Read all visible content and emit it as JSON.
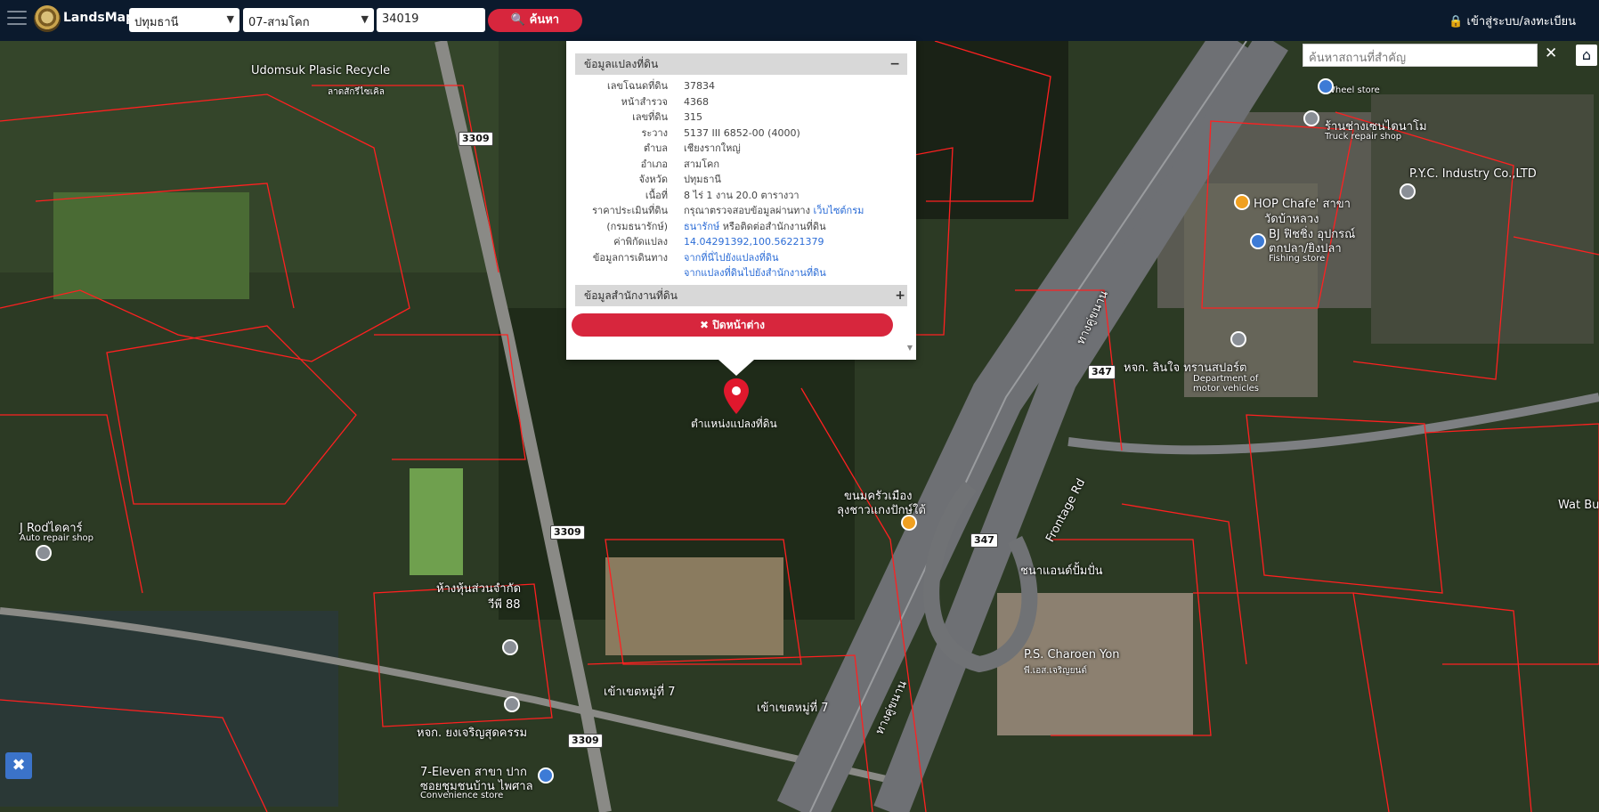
{
  "topbar": {
    "app_name": "LandsMaps",
    "province": "ปทุมธานี",
    "district": "07-สามโคก",
    "parcel_number": "34019",
    "search_label": "ค้นหา",
    "login_label": "เข้าสู่ระบบ/ลงทะเบียน"
  },
  "popup": {
    "section_title": "ข้อมูลแปลงที่ดิน",
    "rows": [
      {
        "k": "เลขโฉนดที่ดิน",
        "v": "37834"
      },
      {
        "k": "หน้าสำรวจ",
        "v": "4368"
      },
      {
        "k": "เลขที่ดิน",
        "v": "315"
      },
      {
        "k": "ระวาง",
        "v": "5137 III 6852-00 (4000)"
      },
      {
        "k": "ตำบล",
        "v": "เชียงรากใหญ่"
      },
      {
        "k": "อำเภอ",
        "v": "สามโคก"
      },
      {
        "k": "จังหวัด",
        "v": "ปทุมธานี"
      },
      {
        "k": "เนื้อที่",
        "v": "8 ไร่ 1 งาน 20.0 ตารางวา"
      }
    ],
    "price_label": "ราคาประเมินที่ดิน",
    "price_label2": "(กรมธนารักษ์)",
    "price_text1": "กรุณาตรวจสอบข้อมูลผ่านทาง",
    "price_link1": "เว็บไซต์กรม",
    "price_link2": "ธนารักษ์",
    "price_text2": "หรือติดต่อสำนักงานที่ดิน",
    "coord_label": "ค่าพิกัดแปลง",
    "coord_value": "14.04291392,100.56221379",
    "travel_label": "ข้อมูลการเดินทาง",
    "travel_link1": "จากที่นี่ไปยังแปลงที่ดิน",
    "travel_link2": "จากแปลงที่ดินไปยังสำนักงานที่ดิน",
    "section2_title": "ข้อมูลสำนักงานที่ดิน",
    "close_label": "✖ ปิดหน้าต่าง"
  },
  "map": {
    "pin_label": "ตำแหน่งแปลงที่ดิน",
    "place_search_placeholder": "ค้นหาสถานที่สำคัญ",
    "labels": {
      "udomsuk": "Udomsuk Plasic Recycle",
      "udomsuk_th": "ลาดสักรีไซเคิล",
      "wheel": "Wheel store",
      "truck_th": "ร้านช่างเซนไดนาโม",
      "truck": "Truck repair shop",
      "pyc": "P.Y.C. Industry Co.,LTD",
      "hop": "HOP Chafe' สาขา",
      "hop2": "วัดบ้าหลวง",
      "bj": "BJ ฟิชชิ่ง อุปกรณ์",
      "bj2": "ตกปลา/ยิงปลา",
      "fishing": "Fishing store",
      "dept_th": "หจก. ลินใจ ทรานสปอร์ต",
      "dept": "Department of motor vehicles",
      "road_north": "ทางคู่ขนาน",
      "frontage": "Frontage Rd",
      "road_south": "ทางคู่ขนาน",
      "jrod_th": "J Rodไดคาร์",
      "jrod": "Auto repair shop",
      "khanom": "ขนมครัวเมือง",
      "khanom2": "ลุงชาวแกงปักษ์ใต้",
      "wat": "Wat Bu",
      "dan": "ชนาแอนด์ปั้มปั่น",
      "ps": "P.S. Charoen Yon",
      "ps2": "พี.เอส.เจริญยนต์",
      "mart": "ห้างหุ้นส่วนจำกัด",
      "mart2": "วีพี 88",
      "mu": "เข้าเขตหมู่ที่ 7",
      "mu2": "เข้าเขตหมู่ที่ 7",
      "hok": "หจก. ยงเจริญสุดครรม",
      "seven": "7-Eleven สาขา ปาก",
      "seven2": "ซอยชุมชนบ้าน ไพศาล",
      "conv": "Convenience store"
    },
    "shields": {
      "s1": "3309",
      "s2": "3309",
      "s3": "3309",
      "s4": "347",
      "s5": "347"
    }
  },
  "colors": {
    "topbar": "#0b1a2d",
    "accent": "#d7263d",
    "parcel_line": "#ff2020"
  },
  "icons": [
    "menu-icon",
    "search-icon",
    "lock-icon",
    "close-icon",
    "home-icon",
    "tools-icon",
    "map-pin-icon"
  ]
}
